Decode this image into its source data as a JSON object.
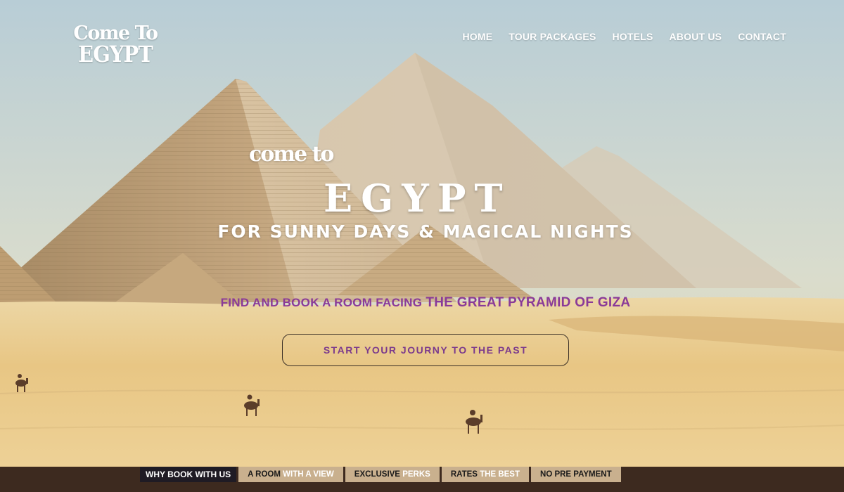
{
  "logo": {
    "line1": "Come To",
    "line2": "EGYPT"
  },
  "nav": {
    "items": [
      "HOME",
      "TOUR PACKAGES",
      "HOTELS",
      "ABOUT US",
      "CONTACT"
    ]
  },
  "hero": {
    "small": "come to",
    "big": "EGYPT",
    "tagline": "FOR SUNNY DAYS & MAGICAL NIGHTS",
    "find_prefix": "FIND AND BOOK A ROOM FACING",
    "find_highlight": "THE GREAT PYRAMID OF GIZA",
    "cta": "START YOUR JOURNY TO THE PAST"
  },
  "bottom_bar": {
    "lead": "WHY BOOK WITH US",
    "items": [
      {
        "a": "A ROOM",
        "b": "WITH A VIEW"
      },
      {
        "a": "EXCLUSIVE",
        "b": "PERKS"
      },
      {
        "a": "RATES",
        "b": "THE BEST"
      },
      {
        "a": "NO PRE PAYMENT",
        "b": ""
      }
    ]
  },
  "colors": {
    "sky": "#c7d6de",
    "sand": "#e6c586",
    "accent_purple": "#8a3a98",
    "bar_brown": "#3d2a1f",
    "bar_tan": "#c9b08e"
  }
}
